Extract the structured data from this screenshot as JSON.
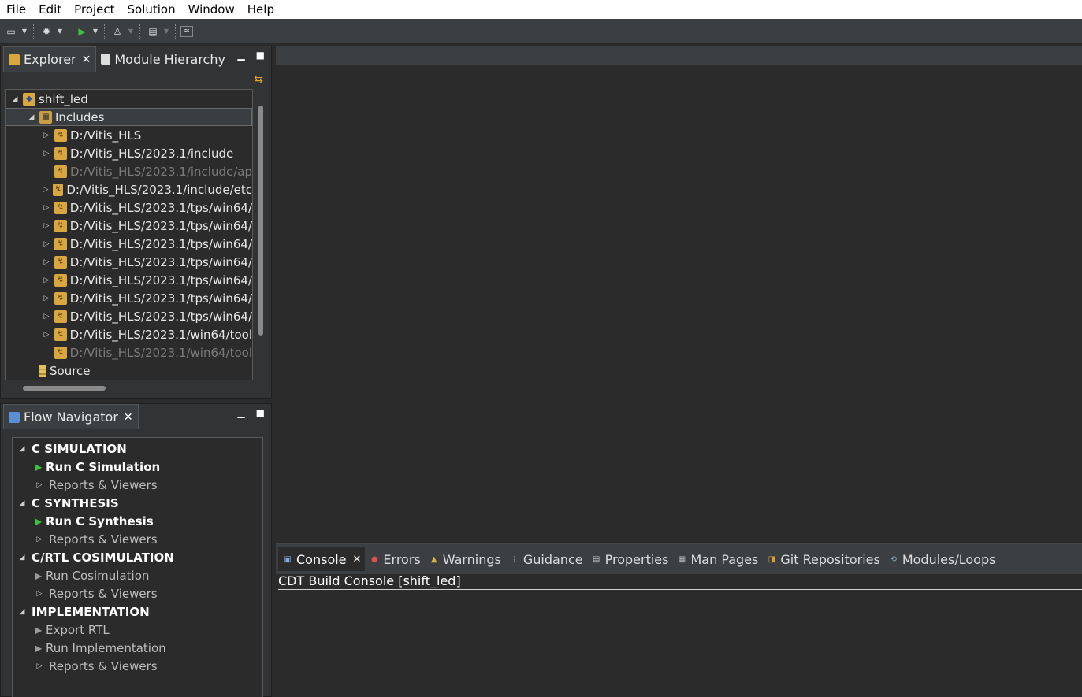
{
  "menu": [
    "File",
    "Edit",
    "Project",
    "Solution",
    "Window",
    "Help"
  ],
  "toolbar": {
    "icons": [
      "open-icon",
      "settings-icon",
      "run-icon",
      "debug-icon",
      "export-icon",
      "compare-icon"
    ]
  },
  "explorer": {
    "tabs": [
      {
        "label": "Explorer",
        "icon": "explorer-icon"
      },
      {
        "label": "Module Hierarchy",
        "icon": "hierarchy-icon"
      }
    ],
    "tree": [
      {
        "label": "shift_led",
        "level": 0,
        "twisty": "open",
        "icon": "project"
      },
      {
        "label": "Includes",
        "level": 1,
        "twisty": "open",
        "icon": "includes",
        "selected": true
      },
      {
        "label": "D:/Vitis_HLS",
        "level": 2,
        "twisty": "closed",
        "icon": "folder"
      },
      {
        "label": "D:/Vitis_HLS/2023.1/include",
        "level": 2,
        "twisty": "closed",
        "icon": "folder"
      },
      {
        "label": "D:/Vitis_HLS/2023.1/include/ap",
        "level": 2,
        "twisty": "",
        "icon": "folder",
        "dim": true
      },
      {
        "label": "D:/Vitis_HLS/2023.1/include/etc",
        "level": 2,
        "twisty": "closed",
        "icon": "folder"
      },
      {
        "label": "D:/Vitis_HLS/2023.1/tps/win64/",
        "level": 2,
        "twisty": "closed",
        "icon": "folder"
      },
      {
        "label": "D:/Vitis_HLS/2023.1/tps/win64/",
        "level": 2,
        "twisty": "closed",
        "icon": "folder"
      },
      {
        "label": "D:/Vitis_HLS/2023.1/tps/win64/",
        "level": 2,
        "twisty": "closed",
        "icon": "folder"
      },
      {
        "label": "D:/Vitis_HLS/2023.1/tps/win64/",
        "level": 2,
        "twisty": "closed",
        "icon": "folder"
      },
      {
        "label": "D:/Vitis_HLS/2023.1/tps/win64/",
        "level": 2,
        "twisty": "closed",
        "icon": "folder"
      },
      {
        "label": "D:/Vitis_HLS/2023.1/tps/win64/",
        "level": 2,
        "twisty": "closed",
        "icon": "folder"
      },
      {
        "label": "D:/Vitis_HLS/2023.1/tps/win64/",
        "level": 2,
        "twisty": "closed",
        "icon": "folder"
      },
      {
        "label": "D:/Vitis_HLS/2023.1/win64/tool",
        "level": 2,
        "twisty": "closed",
        "icon": "folder"
      },
      {
        "label": "D:/Vitis_HLS/2023.1/win64/tool",
        "level": 2,
        "twisty": "",
        "icon": "folder",
        "dim": true
      },
      {
        "label": "Source",
        "level": 1,
        "twisty": "",
        "icon": "source"
      }
    ]
  },
  "flow_navigator": {
    "title": "Flow Navigator",
    "sections": [
      {
        "title": "C SIMULATION",
        "items": [
          {
            "label": "Run C Simulation",
            "type": "run",
            "enabled": true
          },
          {
            "label": "Reports & Viewers",
            "type": "sub"
          }
        ]
      },
      {
        "title": "C SYNTHESIS",
        "items": [
          {
            "label": "Run C Synthesis",
            "type": "run",
            "enabled": true
          },
          {
            "label": "Reports & Viewers",
            "type": "sub"
          }
        ]
      },
      {
        "title": "C/RTL COSIMULATION",
        "items": [
          {
            "label": "Run Cosimulation",
            "type": "run",
            "enabled": false
          },
          {
            "label": "Reports & Viewers",
            "type": "sub"
          }
        ]
      },
      {
        "title": "IMPLEMENTATION",
        "items": [
          {
            "label": "Export RTL",
            "type": "run",
            "enabled": false
          },
          {
            "label": "Run Implementation",
            "type": "run",
            "enabled": false
          },
          {
            "label": "Reports & Viewers",
            "type": "sub"
          }
        ]
      }
    ]
  },
  "console": {
    "tabs": [
      {
        "label": "Console",
        "icon": "console-icon",
        "active": true
      },
      {
        "label": "Errors",
        "icon": "errors-icon"
      },
      {
        "label": "Warnings",
        "icon": "warnings-icon"
      },
      {
        "label": "Guidance",
        "icon": "guidance-icon"
      },
      {
        "label": "Properties",
        "icon": "properties-icon"
      },
      {
        "label": "Man Pages",
        "icon": "man-pages-icon"
      },
      {
        "label": "Git Repositories",
        "icon": "git-icon"
      },
      {
        "label": "Modules/Loops",
        "icon": "modules-icon"
      }
    ],
    "title": "CDT Build Console [shift_led]"
  },
  "colors": {
    "background": "#2b2b2b",
    "panel": "#3c3f41",
    "run_green": "#3fbf3f"
  }
}
